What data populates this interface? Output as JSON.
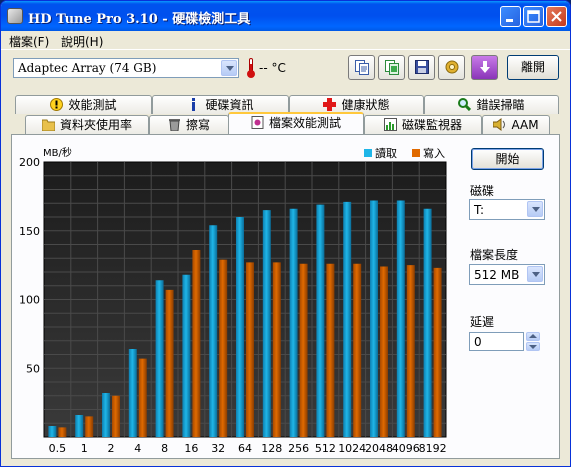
{
  "window": {
    "title": "HD Tune Pro 3.10 - 硬碟檢測工具"
  },
  "menu": {
    "items": [
      "檔案(F)",
      "說明(H)"
    ]
  },
  "toolbar": {
    "drive": "Adaptec Array (74 GB)",
    "temperature": "-- °C",
    "exit_label": "離開",
    "icons": [
      "copy-text-icon",
      "copy-screenshot-icon",
      "save-icon",
      "options-icon",
      "download-icon"
    ]
  },
  "tabs": {
    "row1": [
      {
        "label": "效能測試",
        "icon": "exclamation-icon"
      },
      {
        "label": "硬碟資訊",
        "icon": "info-icon"
      },
      {
        "label": "健康狀態",
        "icon": "red-cross-icon"
      },
      {
        "label": "錯誤掃瞄",
        "icon": "magnifier-icon"
      }
    ],
    "row2": [
      {
        "label": "資料夾使用率",
        "icon": "folder-icon"
      },
      {
        "label": "擦寫",
        "icon": "trash-icon"
      },
      {
        "label": "檔案效能測試",
        "icon": "file-benchmark-icon",
        "active": true
      },
      {
        "label": "磁碟監視器",
        "icon": "monitor-icon"
      },
      {
        "label": "AAM",
        "icon": "speaker-icon"
      }
    ]
  },
  "controls": {
    "start_label": "開始",
    "drive_label": "磁碟",
    "drive_value": "T:",
    "file_length_label": "檔案長度",
    "file_length_value": "512 MB",
    "delay_label": "延遲",
    "delay_value": "0"
  },
  "colors": {
    "read": "#1fb6e8",
    "write": "#e06a00",
    "accent": "#ffc83c"
  },
  "chart_data": {
    "type": "bar",
    "ylabel": "MB/秒",
    "ylim": [
      0,
      200
    ],
    "yticks": [
      50,
      100,
      150,
      200
    ],
    "categories": [
      "0.5",
      "1",
      "2",
      "4",
      "8",
      "16",
      "32",
      "64",
      "128",
      "256",
      "512",
      "1024",
      "2048",
      "4096",
      "8192"
    ],
    "series": [
      {
        "name": "讀取",
        "values": [
          8,
          16,
          32,
          64,
          114,
          118,
          154,
          160,
          165,
          166,
          169,
          171,
          172,
          172,
          166
        ]
      },
      {
        "name": "寫入",
        "values": [
          7,
          15,
          30,
          57,
          107,
          136,
          129,
          127,
          127,
          126,
          126,
          126,
          124,
          125,
          123
        ]
      }
    ],
    "grid": true,
    "legend": "top-right"
  }
}
